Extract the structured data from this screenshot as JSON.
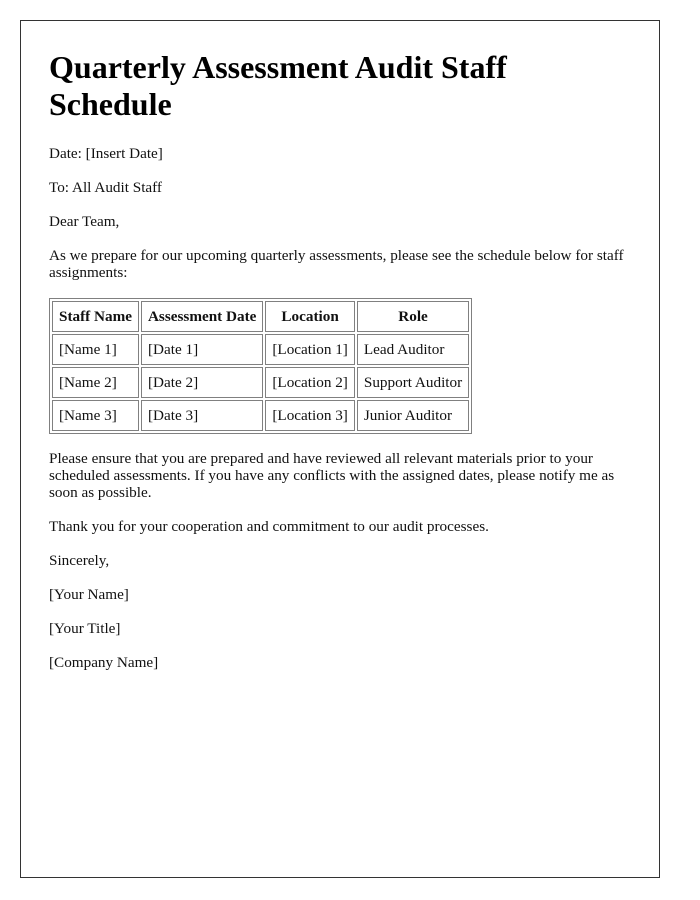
{
  "document": {
    "title": "Quarterly Assessment Audit Staff Schedule",
    "date_line": "Date: [Insert Date]",
    "to_line": "To: All Audit Staff",
    "greeting": "Dear Team,",
    "intro": "As we prepare for our upcoming quarterly assessments, please see the schedule below for staff assignments:",
    "table": {
      "headers": [
        "Staff Name",
        "Assessment Date",
        "Location",
        "Role"
      ],
      "rows": [
        [
          "[Name 1]",
          "[Date 1]",
          "[Location 1]",
          "Lead Auditor"
        ],
        [
          "[Name 2]",
          "[Date 2]",
          "[Location 2]",
          "Support Auditor"
        ],
        [
          "[Name 3]",
          "[Date 3]",
          "[Location 3]",
          "Junior Auditor"
        ]
      ]
    },
    "body_paragraph": "Please ensure that you are prepared and have reviewed all relevant materials prior to your scheduled assessments. If you have any conflicts with the assigned dates, please notify me as soon as possible.",
    "thanks": "Thank you for your cooperation and commitment to our audit processes.",
    "closing": "Sincerely,",
    "signature_name": "[Your Name]",
    "signature_title": "[Your Title]",
    "signature_company": "[Company Name]"
  }
}
